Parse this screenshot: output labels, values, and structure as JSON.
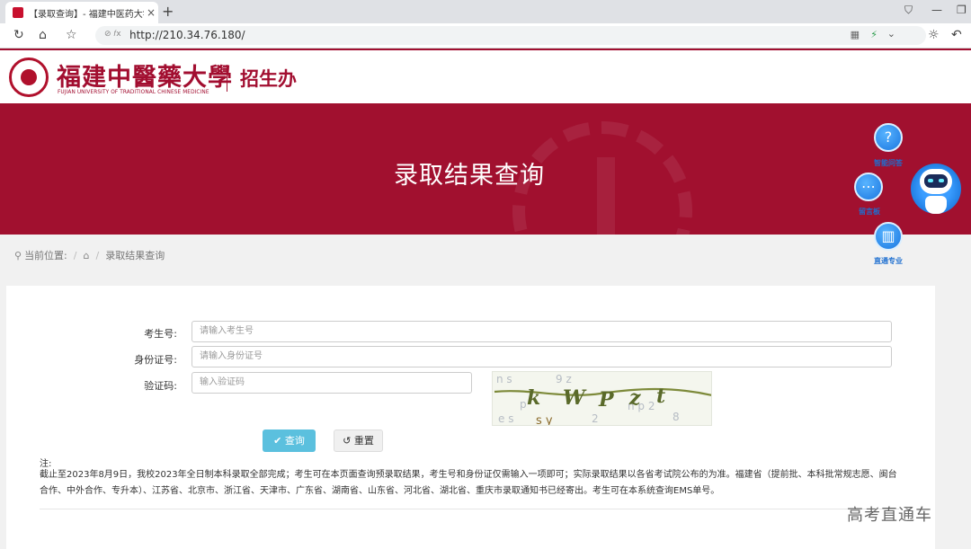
{
  "browser": {
    "tab_title": "【录取查询】- 福建中医药大学",
    "tab_close": "×",
    "new_tab": "+",
    "url_security": "⊘ 𝑓x",
    "url": "http://210.34.76.180/"
  },
  "header": {
    "university_name": "福建中醫藥大學",
    "university_en": "FUJIAN UNIVERSITY OF TRADITIONAL CHINESE MEDICINE",
    "department": "招生办"
  },
  "banner": {
    "title": "录取结果查询"
  },
  "float_widgets": {
    "qa_label": "智能问答",
    "board_label": "留言板",
    "major_label": "直通专业"
  },
  "breadcrumb": {
    "prefix": "当前位置:",
    "separator": "/",
    "current": "录取结果查询"
  },
  "form": {
    "exam_no_label": "考生号:",
    "exam_no_placeholder": "请输入考生号",
    "id_label": "身份证号:",
    "id_placeholder": "请输入身份证号",
    "captcha_label": "验证码:",
    "captcha_placeholder": "输入验证码",
    "query_button": "查询",
    "reset_button": "重置"
  },
  "notice": {
    "title": "注:",
    "text": "截止至2023年8月9日，我校2023年全日制本科录取全部完成；考生可在本页面查询预录取结果，考生号和身份证仅需输入一项即可；实际录取结果以各省考试院公布的为准。福建省（提前批、本科批常规志愿、闽台合作、中外合作、专升本）、江苏省、北京市、浙江省、天津市、广东省、湖南省、山东省、河北省、湖北省、重庆市录取通知书已经寄出。考生可在本系统查询EMS单号。"
  },
  "watermark": "高考直通车"
}
